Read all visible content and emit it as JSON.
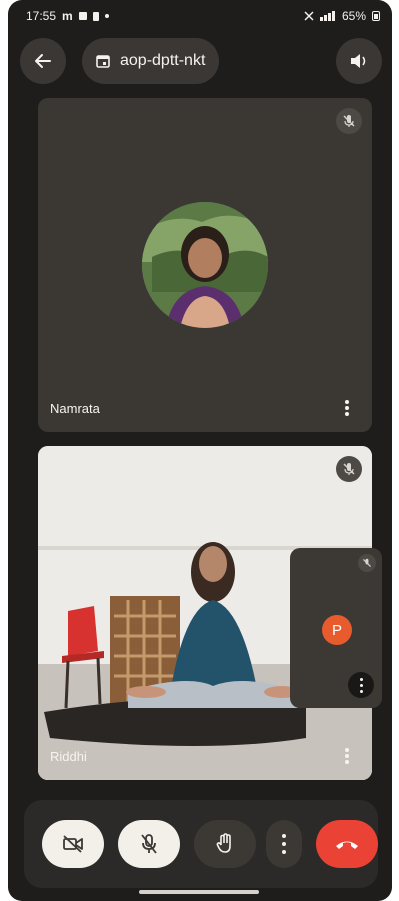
{
  "status_bar": {
    "time": "17:55",
    "battery": "65%"
  },
  "header": {
    "meeting_code": "aop-dptt-nkt",
    "icons": {
      "back": "back-arrow-icon",
      "calendar": "calendar-icon",
      "speaker": "speaker-icon"
    }
  },
  "participants": [
    {
      "name": "Namrata",
      "muted": true
    },
    {
      "name": "Riddhi",
      "muted": true
    }
  ],
  "self_view": {
    "initial": "P",
    "muted": true,
    "avatar_color": "#e85b2c"
  },
  "controls": {
    "camera": "camera-off-icon",
    "microphone": "mic-off-icon",
    "raise_hand": "raise-hand-icon",
    "more": "more-options-icon",
    "end_call": "end-call-icon",
    "end_call_color": "#ea4335"
  }
}
